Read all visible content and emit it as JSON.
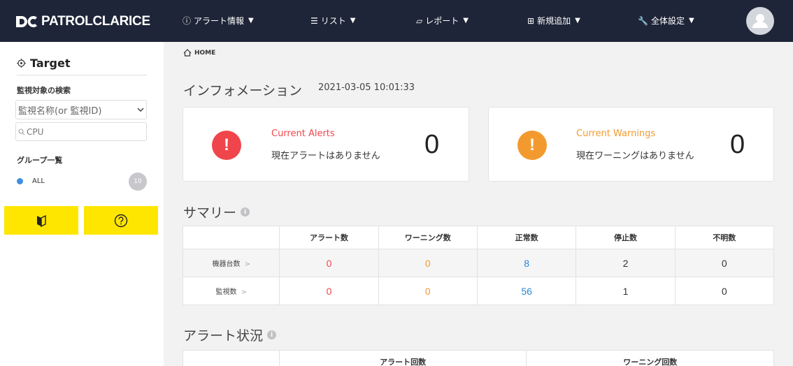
{
  "nav": {
    "logo": "PATROLCLARICE",
    "items": [
      {
        "icon": "ⓘ",
        "label": "アラート情報"
      },
      {
        "icon": "☰",
        "label": "リスト"
      },
      {
        "icon": "▱",
        "label": "レポート"
      },
      {
        "icon": "⊞",
        "label": "新規追加"
      },
      {
        "icon": "🔧",
        "label": "全体設定"
      }
    ],
    "caret": "▼"
  },
  "sidebar": {
    "title": "Target",
    "search_label": "監視対象の検索",
    "select_value": "監視名称(or 監視ID)",
    "search_value": "CPU",
    "group_label": "グループ一覧",
    "group": {
      "name": "ALL",
      "count": "10"
    }
  },
  "breadcrumb": "HOME",
  "info": {
    "title": "インフォメーション",
    "timestamp": "2021-03-05 10:01:33",
    "alerts": {
      "title": "Current Alerts",
      "message": "現在アラートはありません",
      "count": "0",
      "color": "#f0454b"
    },
    "warnings": {
      "title": "Current Warnings",
      "message": "現在ワーニングはありません",
      "count": "0",
      "color": "#f39a2e"
    }
  },
  "summary": {
    "title": "サマリー",
    "headers": [
      "アラート数",
      "ワーニング数",
      "正常数",
      "停止数",
      "不明数"
    ],
    "rows": [
      {
        "label": "機器台数",
        "values": [
          "0",
          "0",
          "8",
          "2",
          "0"
        ]
      },
      {
        "label": "監視数",
        "values": [
          "0",
          "0",
          "56",
          "1",
          "0"
        ]
      }
    ]
  },
  "alert_status": {
    "title": "アラート状況",
    "headers": [
      "アラート回数",
      "ワーニング回数"
    ]
  },
  "colors": {
    "nav_bg": "#1f2538",
    "yellow": "#ffe600",
    "alert": "#f0454b",
    "warning": "#f39a2e",
    "normal": "#2d86d6"
  }
}
